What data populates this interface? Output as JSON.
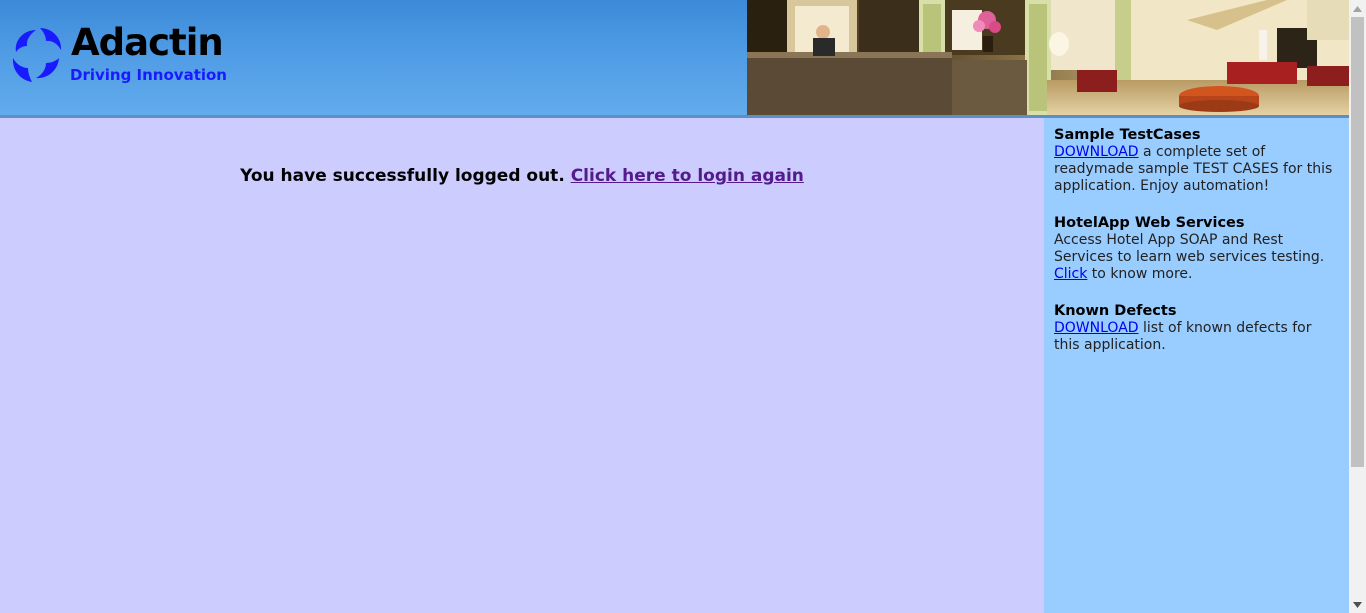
{
  "header": {
    "logo": {
      "name": "Adactin",
      "tagline": "Driving Innovation"
    },
    "banner_image": "hotel-lobby-photo"
  },
  "main": {
    "message": "You have successfully logged out.",
    "login_link": "Click here to login again"
  },
  "sidebar": {
    "sections": [
      {
        "title": "Sample TestCases",
        "link": "DOWNLOAD",
        "text": " a complete set of readymade sample TEST CASES for this application. Enjoy automation!"
      },
      {
        "title": "HotelApp Web Services",
        "text_before": "Access Hotel App SOAP and Rest Services to learn web services testing. ",
        "link": "Click",
        "text_after": " to know more."
      },
      {
        "title": "Known Defects",
        "link": "DOWNLOAD",
        "text": " list of known defects for this application."
      }
    ]
  },
  "colors": {
    "page_bg": "#ccccff",
    "sidebar_bg": "#99ccff",
    "header_bg": "#4f9be5",
    "link": "#0000ee",
    "visited_link": "#551a8b",
    "tagline": "#1a1aff"
  }
}
